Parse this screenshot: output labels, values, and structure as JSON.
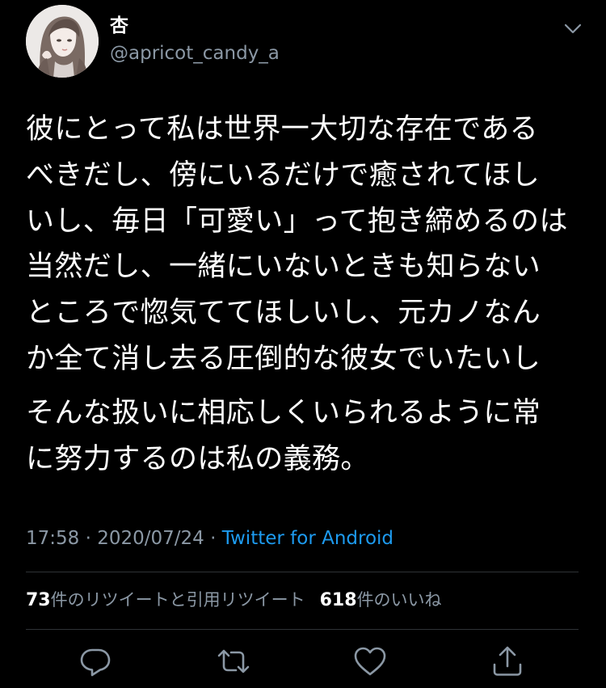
{
  "tweet": {
    "display_name": "杏",
    "handle": "@apricot_candy_a",
    "paragraphs": [
      [
        "彼にとって私は世界一大切な存在である",
        "べきだし、傍にいるだけで癒されてほし",
        "いし、毎日「可愛い」って抱き締めるのは",
        "当然だし、一緒にいないときも知らない",
        "ところで惚気ててほしいし、元カノなん",
        "か全て消し去る圧倒的な彼女でいたいし"
      ],
      [
        "そんな扱いに相応しくいられるように常",
        "に努力するのは私の義務。"
      ]
    ],
    "time": "17:58",
    "date": "2020/07/24",
    "separator": "·",
    "source": "Twitter for Android"
  },
  "stats": {
    "retweet_count": "73",
    "retweet_label": "件のリツイートと引用リツイート",
    "like_count": "618",
    "like_label": "件のいいね"
  },
  "icons": {
    "avatar": "avatar-image",
    "caret": "chevron-down-icon",
    "reply": "reply-icon",
    "retweet": "retweet-icon",
    "like": "heart-icon",
    "share": "share-icon"
  },
  "colors": {
    "background": "#000000",
    "text": "#ffffff",
    "secondary": "#8b98a5",
    "link": "#1d9bf0",
    "divider": "#2f3336"
  }
}
